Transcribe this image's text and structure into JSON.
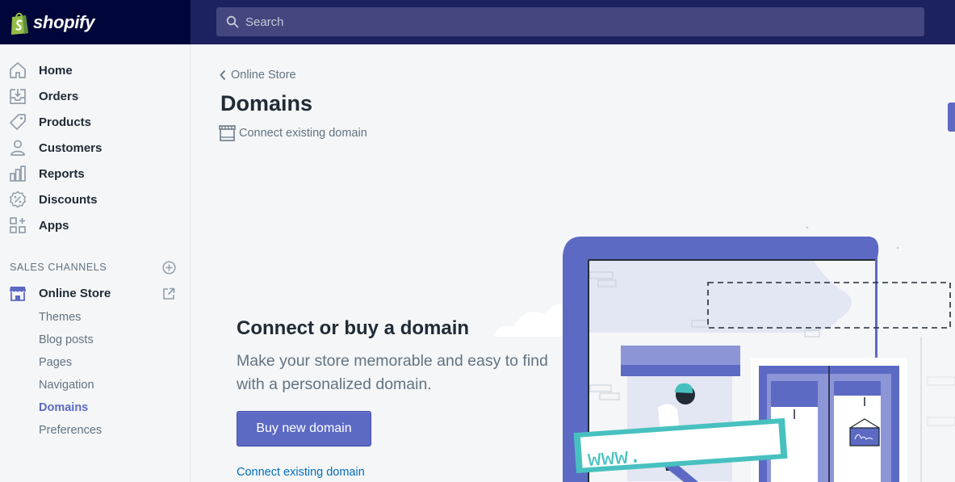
{
  "brand": {
    "name": "shopify",
    "color": "#000639"
  },
  "search": {
    "placeholder": "Search"
  },
  "sidebar": {
    "items": [
      {
        "label": "Home",
        "icon": "home-icon"
      },
      {
        "label": "Orders",
        "icon": "orders-icon"
      },
      {
        "label": "Products",
        "icon": "tag-icon"
      },
      {
        "label": "Customers",
        "icon": "person-icon"
      },
      {
        "label": "Reports",
        "icon": "bar-chart-icon"
      },
      {
        "label": "Discounts",
        "icon": "discount-icon"
      },
      {
        "label": "Apps",
        "icon": "apps-icon"
      }
    ],
    "channels_title": "SALES CHANNELS",
    "online_store": {
      "label": "Online Store",
      "icon": "store-icon"
    },
    "sub_items": [
      {
        "label": "Themes"
      },
      {
        "label": "Blog posts"
      },
      {
        "label": "Pages"
      },
      {
        "label": "Navigation"
      },
      {
        "label": "Domains",
        "active": true
      },
      {
        "label": "Preferences"
      }
    ]
  },
  "page": {
    "breadcrumb": "Online Store",
    "title": "Domains",
    "secondary_action": "Connect existing domain"
  },
  "empty_state": {
    "heading": "Connect or buy a domain",
    "body": "Make your store memorable and easy to find with a personalized domain.",
    "primary_button": "Buy new domain",
    "secondary_link": "Connect existing domain",
    "sign_text": "www."
  },
  "colors": {
    "accent": "#5c6ac4",
    "topbar": "#1c2260",
    "link": "#006fbb",
    "teal": "#47c1bf"
  }
}
